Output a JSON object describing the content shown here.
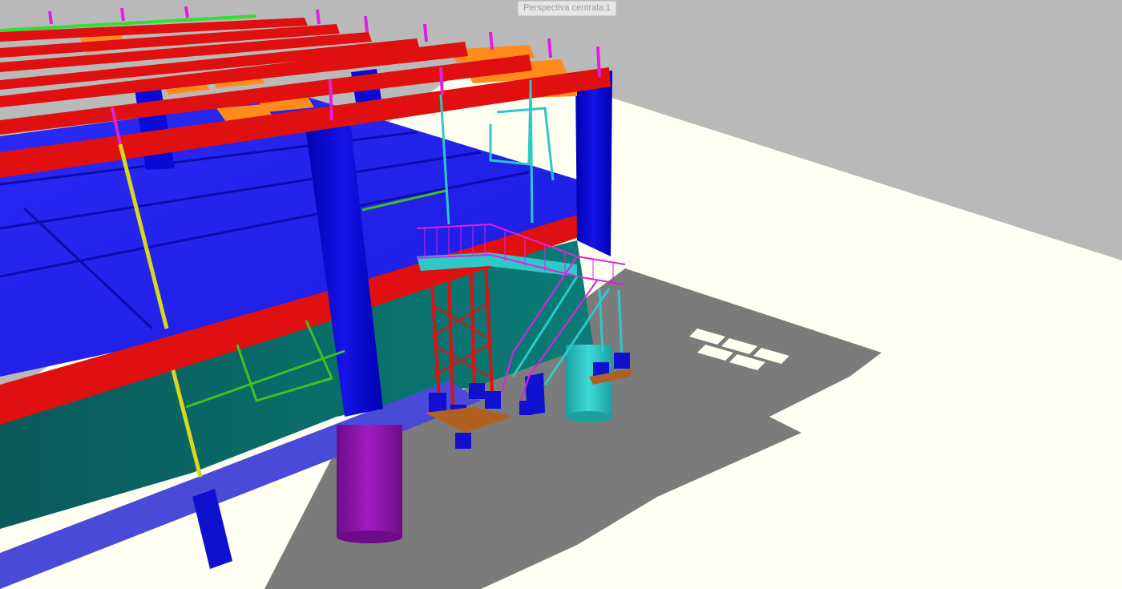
{
  "viewport": {
    "view_label": "Perspectiva centrala:1",
    "colors": {
      "background": "#b9b9b9",
      "ground": "#fffff2",
      "shadow": "#6f7070",
      "slab": "#1f1ff2",
      "column": "#0a0ad6",
      "beam": "#e01010",
      "joist": "#ff8c1a",
      "pile": "#8a14a8",
      "teal_wall": "#0a6e6a",
      "stair_rail": "#e020e0",
      "stair_frame": "#2ec8c8",
      "yellow_member": "#d8d820",
      "green_member": "#40c020"
    }
  }
}
